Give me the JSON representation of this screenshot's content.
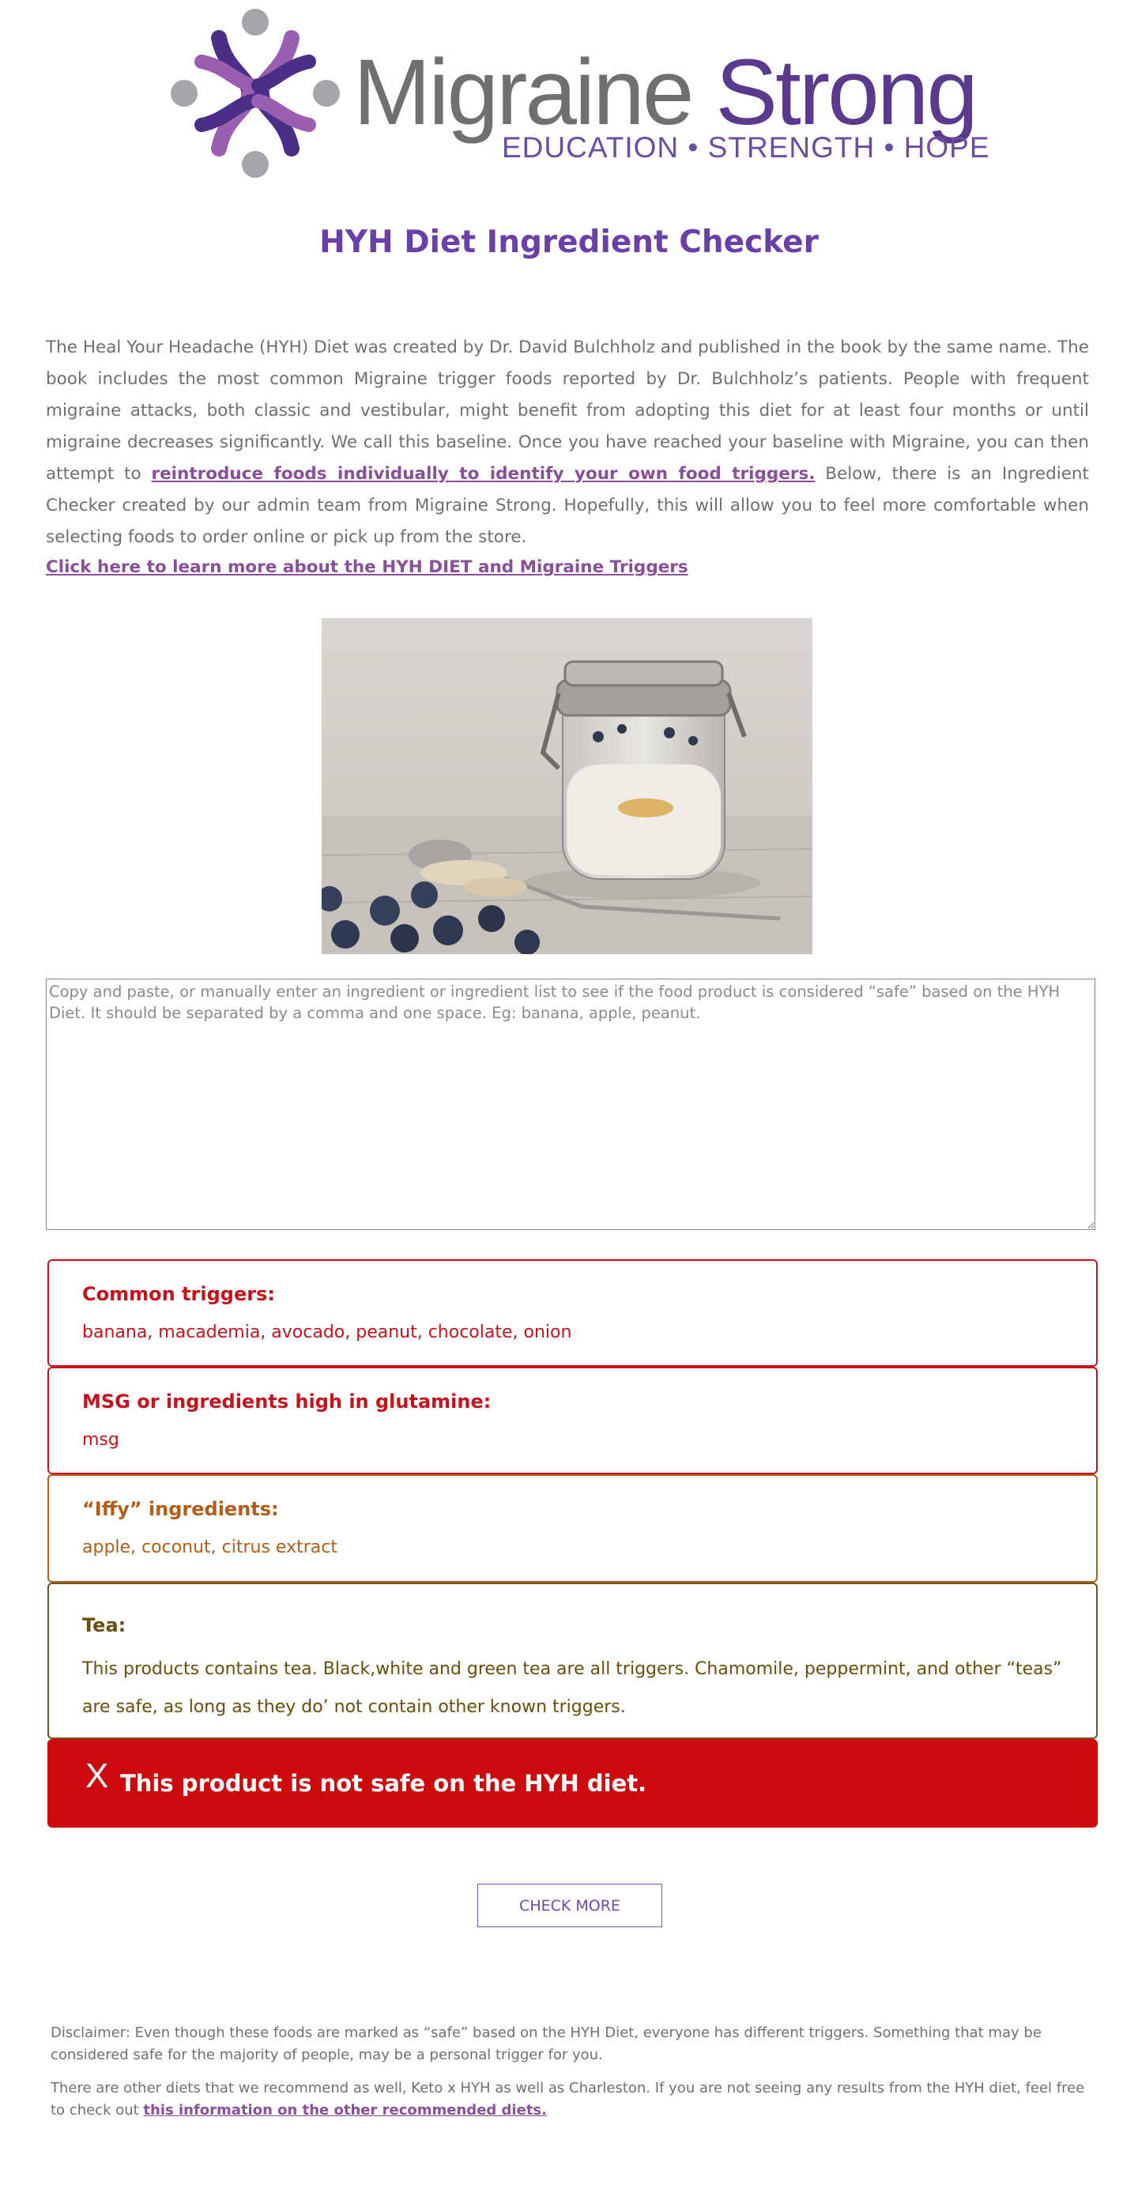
{
  "logo": {
    "word_gray": "Migraine",
    "word_purple": "Strong",
    "tagline": "EDUCATION • STRENGTH • HOPE",
    "colors": {
      "gray": "#707072",
      "purple": "#5b3a8e",
      "light_purple": "#9a5fb0",
      "dark_purple": "#4b2f86",
      "circle_gray": "#a6a6aa"
    }
  },
  "title": "HYH Diet Ingredient Checker",
  "intro": {
    "text_before": "The Heal Your Headache (HYH) Diet was created by Dr. David Bulchholz and published in the book by the same name. The book includes the most common Migraine trigger foods reported by Dr. Bulchholz’s patients. People with frequent migraine attacks, both classic and vestibular, might benefit from adopting this diet for at least four months or until migraine decreases significantly. We call this baseline. Once you have reached your baseline with Migraine, you can then attempt to ",
    "link_text": "reintroduce foods individually to identify your own food triggers.",
    "text_after": " Below, there is an Ingredient Checker created by our admin team from Migraine Strong. Hopefully, this will allow you to feel more comfortable when selecting foods to order online or pick up from the store."
  },
  "learn_link": "Click here to learn more about the HYH DIET and Migraine Triggers",
  "photo": {
    "icon": "overnight-oats-jar-photo"
  },
  "checker": {
    "placeholder": "Copy and paste, or manually enter an ingredient or ingredient list to see if the food product is considered “safe” based on the HYH Diet. It should be separated by a comma and one space. Eg: banana, apple, peanut.",
    "value": ""
  },
  "results": {
    "common": {
      "heading": "Common triggers:",
      "items": "banana, macademia, avocado, peanut, chocolate, onion"
    },
    "msg": {
      "heading": "MSG or ingredients high in glutamine:",
      "items": "msg"
    },
    "iffy": {
      "heading": "“Iffy” ingredients:",
      "items": "apple, coconut, citrus extract"
    },
    "tea": {
      "heading": "Tea:",
      "text": "This products contains tea. Black,white and green tea are all triggers. Chamomile, peppermint, and other “teas” are safe, as long as they do’ not contain other known triggers."
    },
    "verdict": {
      "icon": "X",
      "text": "This product is not safe on the HYH diet.",
      "color": "#cc0a0e"
    }
  },
  "check_more": "CHECK MORE",
  "disclaimer": {
    "p1": "Disclaimer: Even though these foods are marked as “safe” based on the HYH Diet, everyone has different triggers. Something that may be considered safe for the majority of people, may be a personal trigger for you.",
    "p2_text": "There are other diets that we recommend as well, Keto x HYH as well as Charleston. If you are not seeing any results from the HYH diet, feel free to check out ",
    "p2_link": "this information on the other recommended diets."
  }
}
